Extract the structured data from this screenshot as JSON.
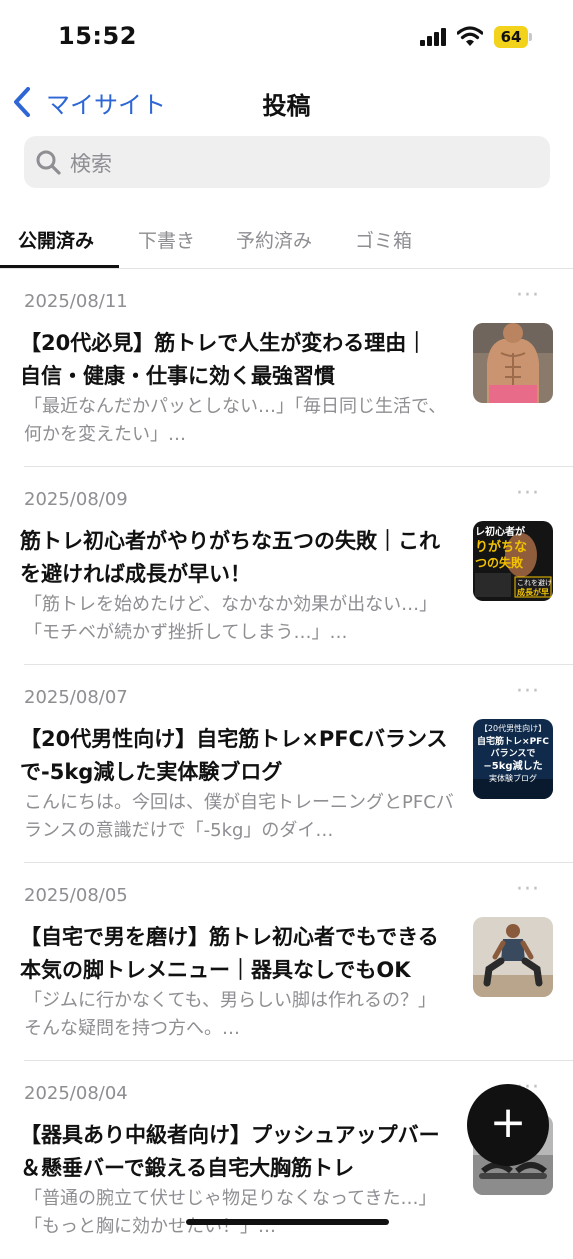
{
  "status_bar": {
    "time": "15:52",
    "battery": "64"
  },
  "nav": {
    "back_label": "マイサイト",
    "title": "投稿"
  },
  "search": {
    "placeholder": "検索"
  },
  "tabs": [
    {
      "label": "公開済み",
      "active": true
    },
    {
      "label": "下書き",
      "active": false
    },
    {
      "label": "予約済み",
      "active": false
    },
    {
      "label": "ゴミ箱",
      "active": false
    }
  ],
  "posts": [
    {
      "date": "2025/08/11",
      "title": "【20代必見】筋トレで人生が変わる理由｜自信・健康・仕事に効く最強習慣",
      "excerpt": "「最近なんだかパッとしない…」「毎日同じ生活で、何かを変えたい」…",
      "more": "···"
    },
    {
      "date": "2025/08/09",
      "title": "筋トレ初心者がやりがちな五つの失敗｜これを避ければ成長が早い！",
      "excerpt": "「筋トレを始めたけど、なかなか効果が出ない…」「モチベが続かず挫折してしまう…」…",
      "more": "···"
    },
    {
      "date": "2025/08/07",
      "title": "【20代男性向け】自宅筋トレ×PFCバランスで-5kg減した実体験ブログ",
      "excerpt": "こんにちは。今回は、僕が自宅トレーニングとPFCバランスの意識だけで「-5kg」のダイ…",
      "more": "···"
    },
    {
      "date": "2025/08/05",
      "title": "【自宅で男を磨け】筋トレ初心者でもできる本気の脚トレメニュー｜器具なしでもOK",
      "excerpt": "「ジムに行かなくても、男らしい脚は作れるの？」そんな疑問を持つ方へ。…",
      "more": "···"
    },
    {
      "date": "2025/08/04",
      "title": "【器具あり中級者向け】プッシュアップバー＆懸垂バーで鍛える自宅大胸筋トレ",
      "excerpt": "「普通の腕立て伏せじゃ物足りなくなってきた…」「もっと胸に効かせたい！」…",
      "more": "···"
    }
  ],
  "thumbs": {
    "t2": {
      "line1": "レ初心者が",
      "line2": "りがちな",
      "line3": "つの失敗",
      "line4": "これを避け",
      "line5": "成長が早"
    },
    "t3": {
      "line1": "【20代男性向け】",
      "line2": "自宅筋トレ×PFC",
      "line3": "バランスで",
      "line4": "−5kg減した",
      "line5": "実体験ブログ"
    }
  },
  "fab": {
    "label": "+"
  },
  "colors": {
    "accent": "#2e66d6",
    "muted": "#8e8e93",
    "battery": "#f2d21a"
  }
}
